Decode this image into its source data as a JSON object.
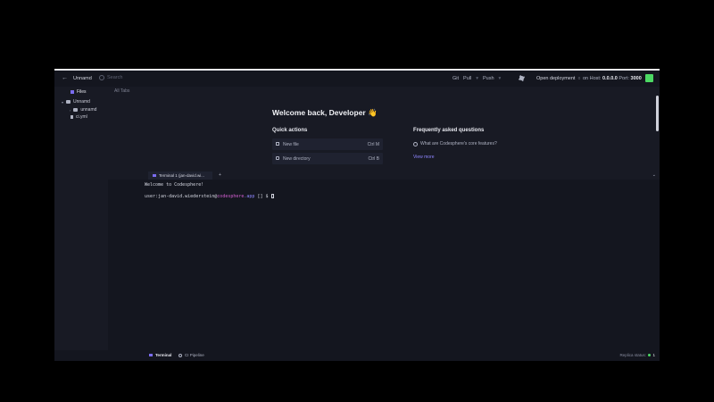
{
  "topbar": {
    "project_name": "Unnamd",
    "search_placeholder": "Search",
    "git_label": "Git",
    "pull_label": "Pull",
    "push_label": "Push",
    "open_deployment_label": "Open deployment",
    "host_label": "on Host:",
    "host_value": "0.0.0.0",
    "port_label": "Port:",
    "port_value": "3000",
    "status_color": "#4cd964"
  },
  "sidebar": {
    "files_tab": "Files",
    "tree": [
      {
        "label": "Unnamd",
        "type": "folder"
      },
      {
        "label": "unnamd",
        "type": "folder"
      },
      {
        "label": "ci.yml",
        "type": "file"
      }
    ]
  },
  "tabs": {
    "all_tabs": "All Tabs"
  },
  "welcome": {
    "title": "Welcome back, Developer 👋",
    "quick_actions_title": "Quick actions",
    "quick_actions": [
      {
        "label": "New file",
        "shortcut": "Ctrl M"
      },
      {
        "label": "New directory",
        "shortcut": "Ctrl B"
      }
    ],
    "faq_title": "Frequently asked questions",
    "faq_items": [
      "What are Codesphere's core features?"
    ],
    "view_more": "View more"
  },
  "terminal": {
    "tab_label": "Terminal 1 (jan-david.wi...",
    "add_label": "+",
    "collapse_label": "⌄",
    "line1": "Welcome to Codesphere!",
    "prompt_user": "user:jan-david.wiederstein",
    "prompt_at": "@",
    "prompt_host": "codesphere",
    "prompt_app": ".app",
    "prompt_rest": " [] $ "
  },
  "bottombar": {
    "terminal_label": "Terminal",
    "pipeline_label": "CI Pipeline",
    "replica_label": "Replica status:",
    "replica_count": "1"
  }
}
